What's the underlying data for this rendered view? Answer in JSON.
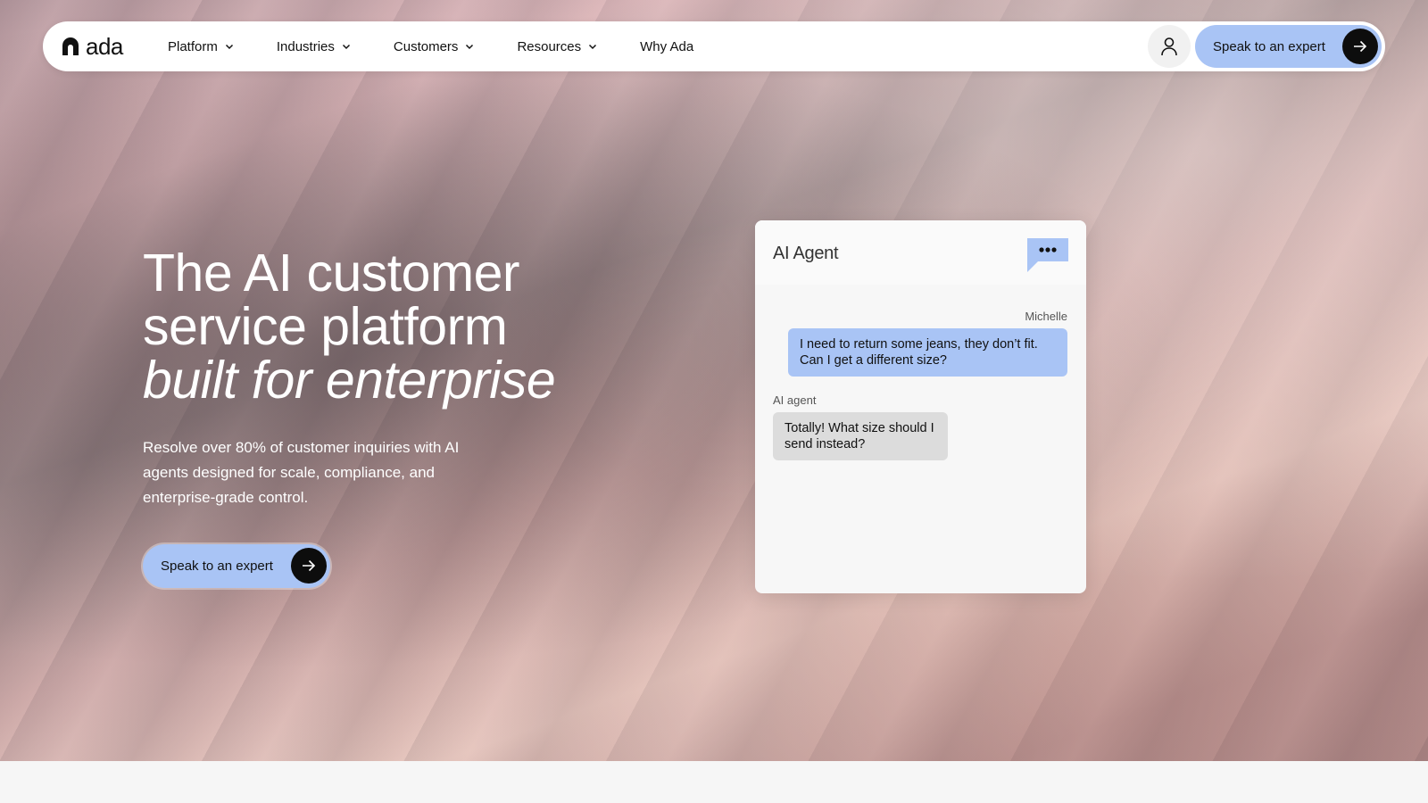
{
  "brand": {
    "name": "ada"
  },
  "nav": {
    "links": [
      {
        "label": "Platform",
        "has_dropdown": true
      },
      {
        "label": "Industries",
        "has_dropdown": true
      },
      {
        "label": "Customers",
        "has_dropdown": true
      },
      {
        "label": "Resources",
        "has_dropdown": true
      },
      {
        "label": "Why Ada",
        "has_dropdown": false
      }
    ],
    "account_icon": "user-icon",
    "cta_label": "Speak to an expert"
  },
  "hero": {
    "headline_line1": "The AI customer",
    "headline_line2": "service platform",
    "headline_line3": "built for enterprise",
    "subhead": "Resolve over 80% of customer inquiries with AI agents designed for scale, compliance, and enterprise-grade control.",
    "cta_label": "Speak to an expert"
  },
  "chat": {
    "title": "AI Agent",
    "header_icon": "chat-bubble-icon",
    "messages": [
      {
        "sender": "Michelle",
        "text": "I need to return some jeans, they don’t fit. Can I get a different size?"
      },
      {
        "sender": "AI agent",
        "text": "Totally! What size should I send instead?"
      }
    ]
  },
  "colors": {
    "accent": "#a9c4f5",
    "dark": "#0d0d0d",
    "agent_bubble": "#dcdcdc"
  }
}
